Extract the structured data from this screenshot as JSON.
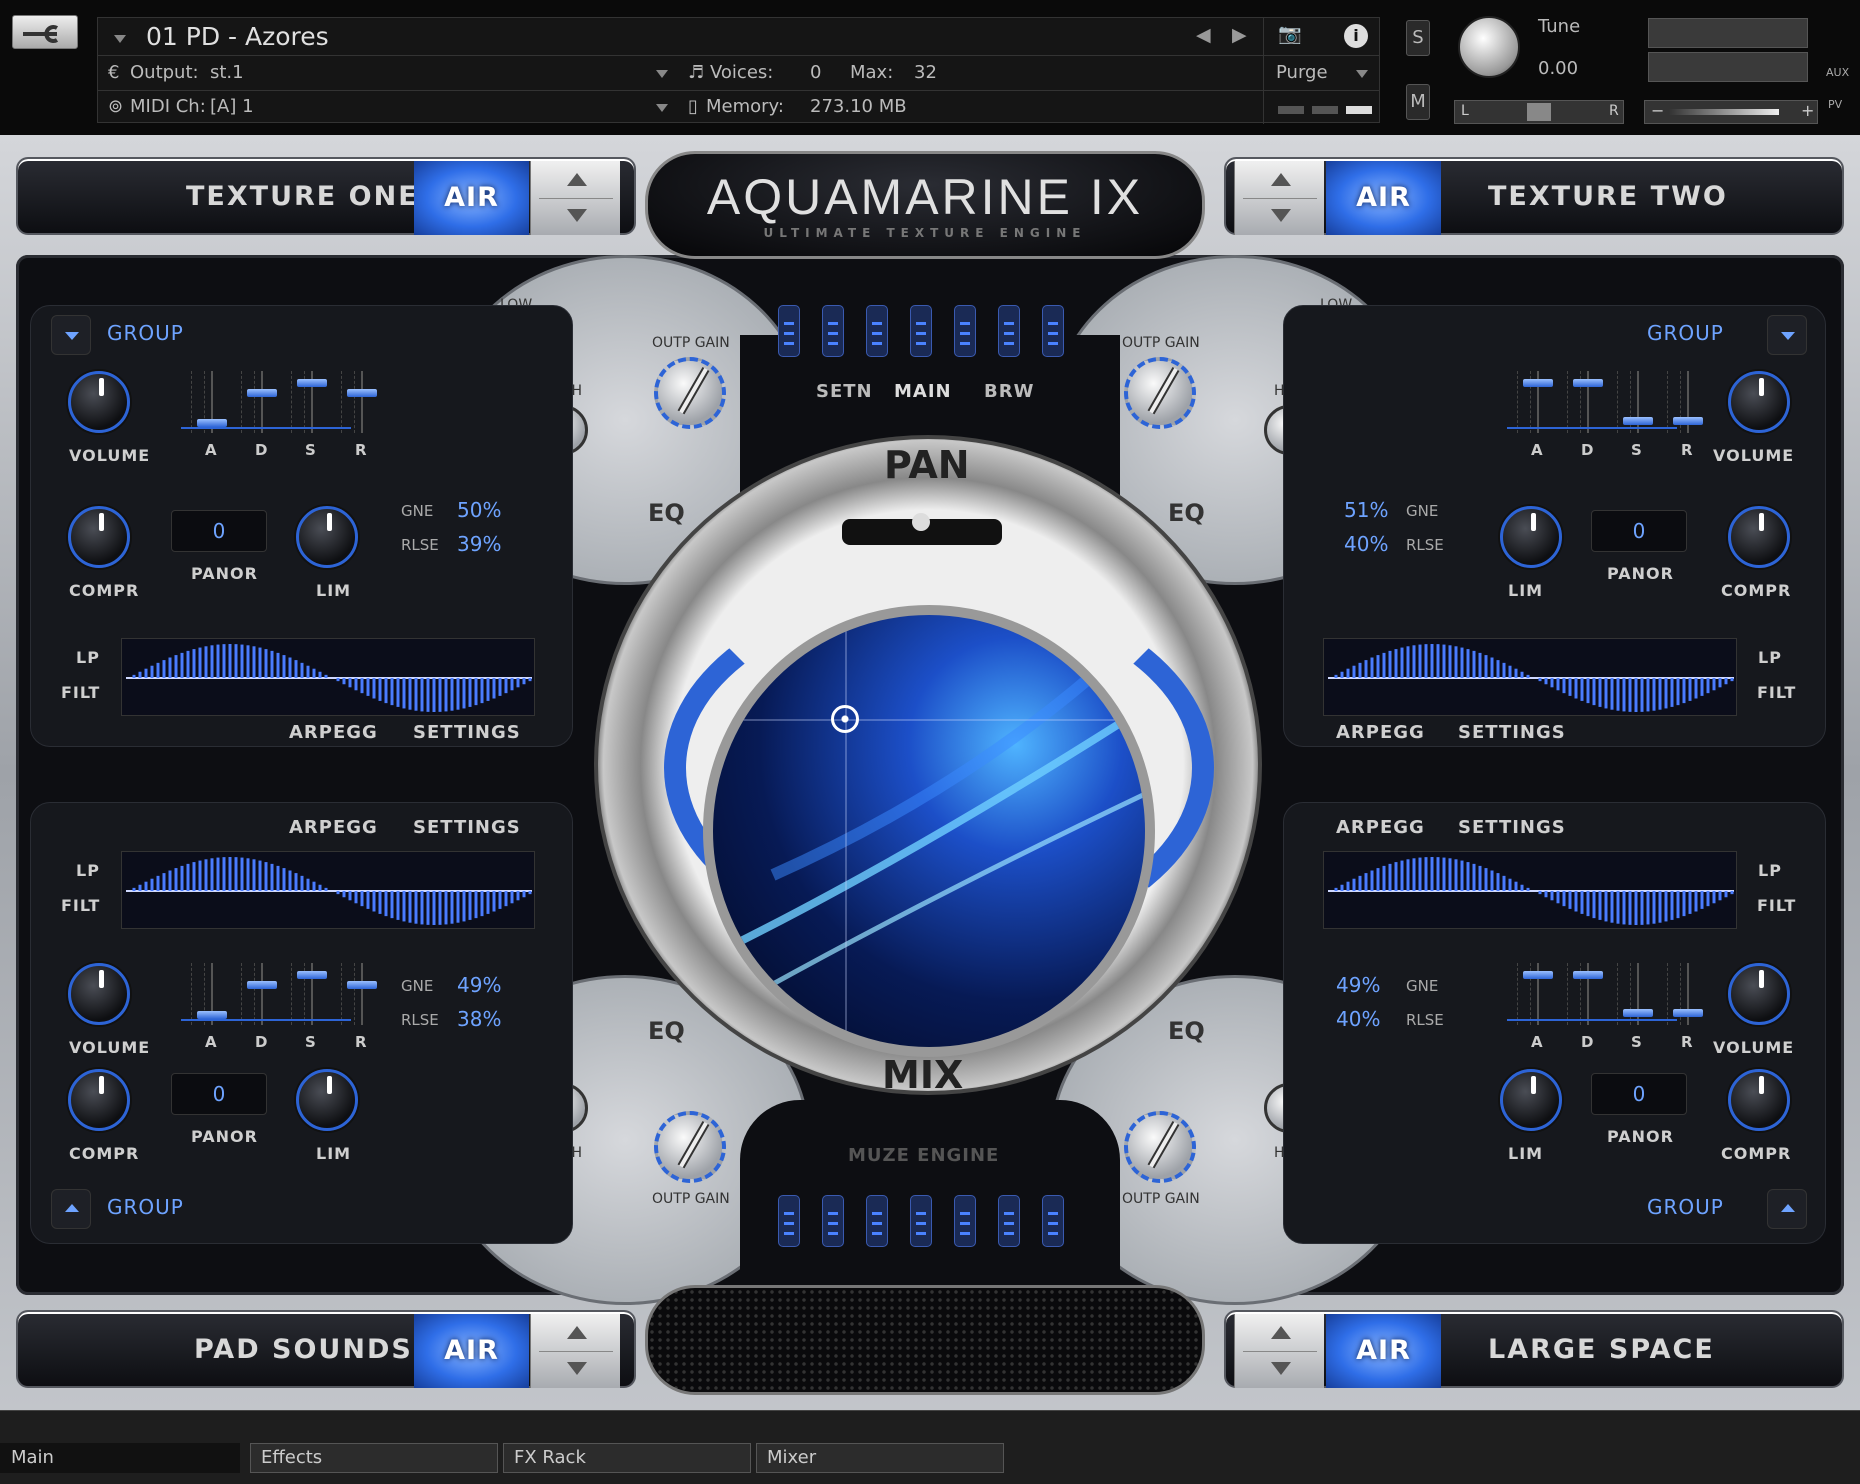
{
  "header": {
    "instrument_name": "01 PD - Azores",
    "output_label": "Output:",
    "output_value": "st.1",
    "midi_label": "MIDI Ch:",
    "midi_value": "[A]  1",
    "voices_label": "Voices:",
    "voices_value": "0",
    "max_label": "Max:",
    "max_value": "32",
    "memory_label": "Memory:",
    "memory_value": "273.10 MB",
    "purge_label": "Purge",
    "solo_label": "S",
    "mute_label": "M",
    "tune_label": "Tune",
    "tune_value": "0.00",
    "pan_left": "L",
    "pan_right": "R",
    "vol_minus": "−",
    "vol_plus": "+",
    "aux_label": "AUX",
    "pv_label": "PV"
  },
  "title": {
    "main": "AQUAMARINE IX",
    "sub": "ULTIMATE TEXTURE ENGINE"
  },
  "textures": {
    "top_left": "TEXTURE ONE",
    "top_right": "TEXTURE TWO",
    "bottom_left": "PAD SOUNDS",
    "bottom_right": "LARGE SPACE",
    "air_label": "AIR"
  },
  "labels": {
    "group": "GROUP",
    "volume": "VOLUME",
    "compr": "COMPR",
    "panor": "PANOR",
    "lim": "LIM",
    "gne": "GNE",
    "rlse": "RLSE",
    "lp": "LP",
    "filt": "FILT",
    "arpegg": "ARPEGG",
    "settings": "SETTINGS",
    "a": "A",
    "d": "D",
    "s": "S",
    "r": "R",
    "low": "LOW",
    "high": "HIGH",
    "outp_gain": "OUTP GAIN",
    "eq": "EQ",
    "pan": "PAN",
    "mix": "MIX",
    "setn": "SETN",
    "main": "MAIN",
    "brw": "BRW",
    "muze_engine": "MUZE ENGINE",
    "panor_value": "0"
  },
  "panels": {
    "top_left": {
      "gne": "50%",
      "rlse": "39%"
    },
    "top_right": {
      "gne": "51%",
      "rlse": "40%"
    },
    "bottom_left": {
      "gne": "49%",
      "rlse": "38%"
    },
    "bottom_right": {
      "gne": "49%",
      "rlse": "40%"
    }
  },
  "tabs": [
    "Main",
    "Effects",
    "FX Rack",
    "Mixer"
  ],
  "colors": {
    "accent": "#2d64d6",
    "accent_light": "#6ea3ff"
  }
}
